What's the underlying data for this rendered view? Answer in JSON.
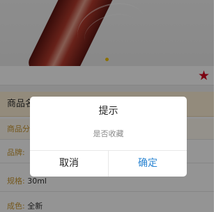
{
  "product": {
    "image_alt": "product photo",
    "carousel": {
      "count": 1,
      "active": 0
    },
    "favorite_icon": "star-icon",
    "name_label": "商品名",
    "category_label": "商品分",
    "brand_label": "品牌:",
    "spec_label": "规格:",
    "spec_value": "30ml",
    "condition_label": "成色:",
    "condition_value": "全新"
  },
  "dialog": {
    "title": "提示",
    "message": "是否收藏",
    "cancel_label": "取消",
    "confirm_label": "确定"
  },
  "colors": {
    "accent": "#2a84d2",
    "favorite": "#d6001c",
    "label_gold": "#c9972f",
    "carousel_active": "#f2c200"
  }
}
